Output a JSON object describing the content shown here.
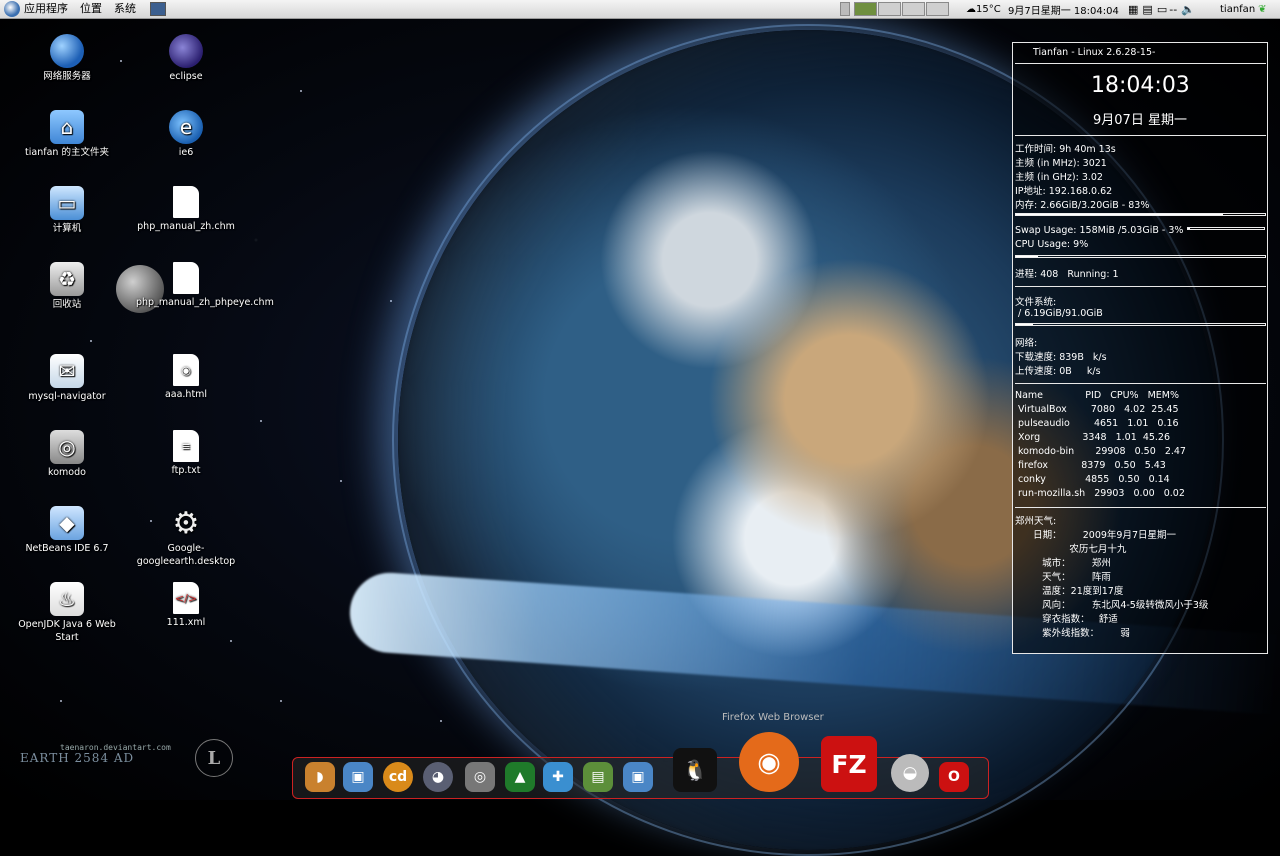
{
  "top_panel": {
    "menus": [
      "应用程序",
      "位置",
      "系统"
    ],
    "temperature": "15°C",
    "clock": "9月7日星期一 18:04:04",
    "user": "tianfan"
  },
  "desktop_icons": [
    {
      "label": "网络服务器",
      "icon": "globe-icon",
      "col": 0,
      "row": 0
    },
    {
      "label": "tianfan 的主文件夹",
      "icon": "home-folder-icon",
      "col": 0,
      "row": 1
    },
    {
      "label": "计算机",
      "icon": "computer-icon",
      "col": 0,
      "row": 2
    },
    {
      "label": "回收站",
      "icon": "trash-icon",
      "col": 0,
      "row": 3
    },
    {
      "label": "mysql-navigator",
      "icon": "mysql-navigator-icon",
      "col": 0,
      "row": 4
    },
    {
      "label": "komodo",
      "icon": "komodo-icon",
      "col": 0,
      "row": 5
    },
    {
      "label": "NetBeans IDE 6.7",
      "icon": "netbeans-icon",
      "col": 0,
      "row": 6
    },
    {
      "label": "OpenJDK Java 6 Web Start",
      "icon": "java-icon",
      "col": 0,
      "row": 7
    },
    {
      "label": "eclipse",
      "icon": "eclipse-icon",
      "col": 1,
      "row": 0
    },
    {
      "label": "ie6",
      "icon": "ie6-icon",
      "col": 1,
      "row": 1
    },
    {
      "label": "php_manual_zh.chm",
      "icon": "file-icon",
      "col": 1,
      "row": 2
    },
    {
      "label": "php_manual_zh_phpeye.chm",
      "icon": "file-icon",
      "col": 1,
      "row": 3
    },
    {
      "label": "aaa.html",
      "icon": "html-file-icon",
      "col": 1,
      "row": 4
    },
    {
      "label": "ftp.txt",
      "icon": "text-file-icon",
      "col": 1,
      "row": 5
    },
    {
      "label": "Google-googleearth.desktop",
      "icon": "gear-icon",
      "col": 1,
      "row": 6
    },
    {
      "label": "111.xml",
      "icon": "xml-file-icon",
      "col": 1,
      "row": 7
    }
  ],
  "conky": {
    "header": "Tianfan - Linux 2.6.28-15-",
    "time": "18:04:03",
    "date": "9月07日 星期一",
    "uptime": "工作时间: 9h 40m 13s",
    "cpu_mhz": "主频 (in MHz): 3021",
    "cpu_ghz": "主频 (in GHz): 3.02",
    "ip": "IP地址: 192.168.0.62",
    "mem": "内存: 2.66GiB/3.20GiB - 83%",
    "mem_pct": 83,
    "swap": "Swap Usage: 158MiB /5.03GiB - 3%",
    "swap_pct": 3,
    "cpu_usage": "CPU Usage: 9%",
    "cpu_pct": 9,
    "procs": "进程: 408   Running: 1",
    "fs_title": "文件系统:",
    "fs_root": " / 6.19GiB/91.0GiB",
    "fs_pct": 7,
    "net_title": "网络:",
    "down": "下载速度: 839B   k/s",
    "up": "上传速度: 0B     k/s",
    "proc_header": "Name              PID   CPU%   MEM%",
    "processes": [
      " VirtualBox        7080   4.02  25.45",
      " pulseaudio        4651   1.01   0.16",
      " Xorg              3348   1.01  45.26",
      " komodo-bin       29908   0.50   2.47",
      " firefox           8379   0.50   5.43",
      " conky             4855   0.50   0.14",
      " run-mozilla.sh   29903   0.00   0.02"
    ],
    "weather_title": "郑州天气:",
    "weather_lines": [
      "      日期：       2009年9月7日星期一",
      "                  农历七月十九",
      "         城市：       郑州",
      "         天气：       阵雨",
      "         温度：21度到17度",
      "         风向：       东北风4-5级转微风小于3级",
      "         穿衣指数：   舒适",
      "         紫外线指数：       弱"
    ]
  },
  "dock": {
    "tooltip": "Firefox Web Browser",
    "items": [
      "bread-icon",
      "virtualbox-icon",
      "cd-icon",
      "gimp-icon",
      "komodo-dock-icon",
      "tree-icon",
      "puzzle-icon",
      "book-icon",
      "virtualbox2-icon",
      "tux-icon",
      "firefox-icon",
      "filezilla-icon",
      "pot-icon",
      "opera-icon"
    ]
  },
  "watermark": {
    "line1": "taenaron.deviantart.com",
    "line2": "EARTH 2584 AD"
  }
}
